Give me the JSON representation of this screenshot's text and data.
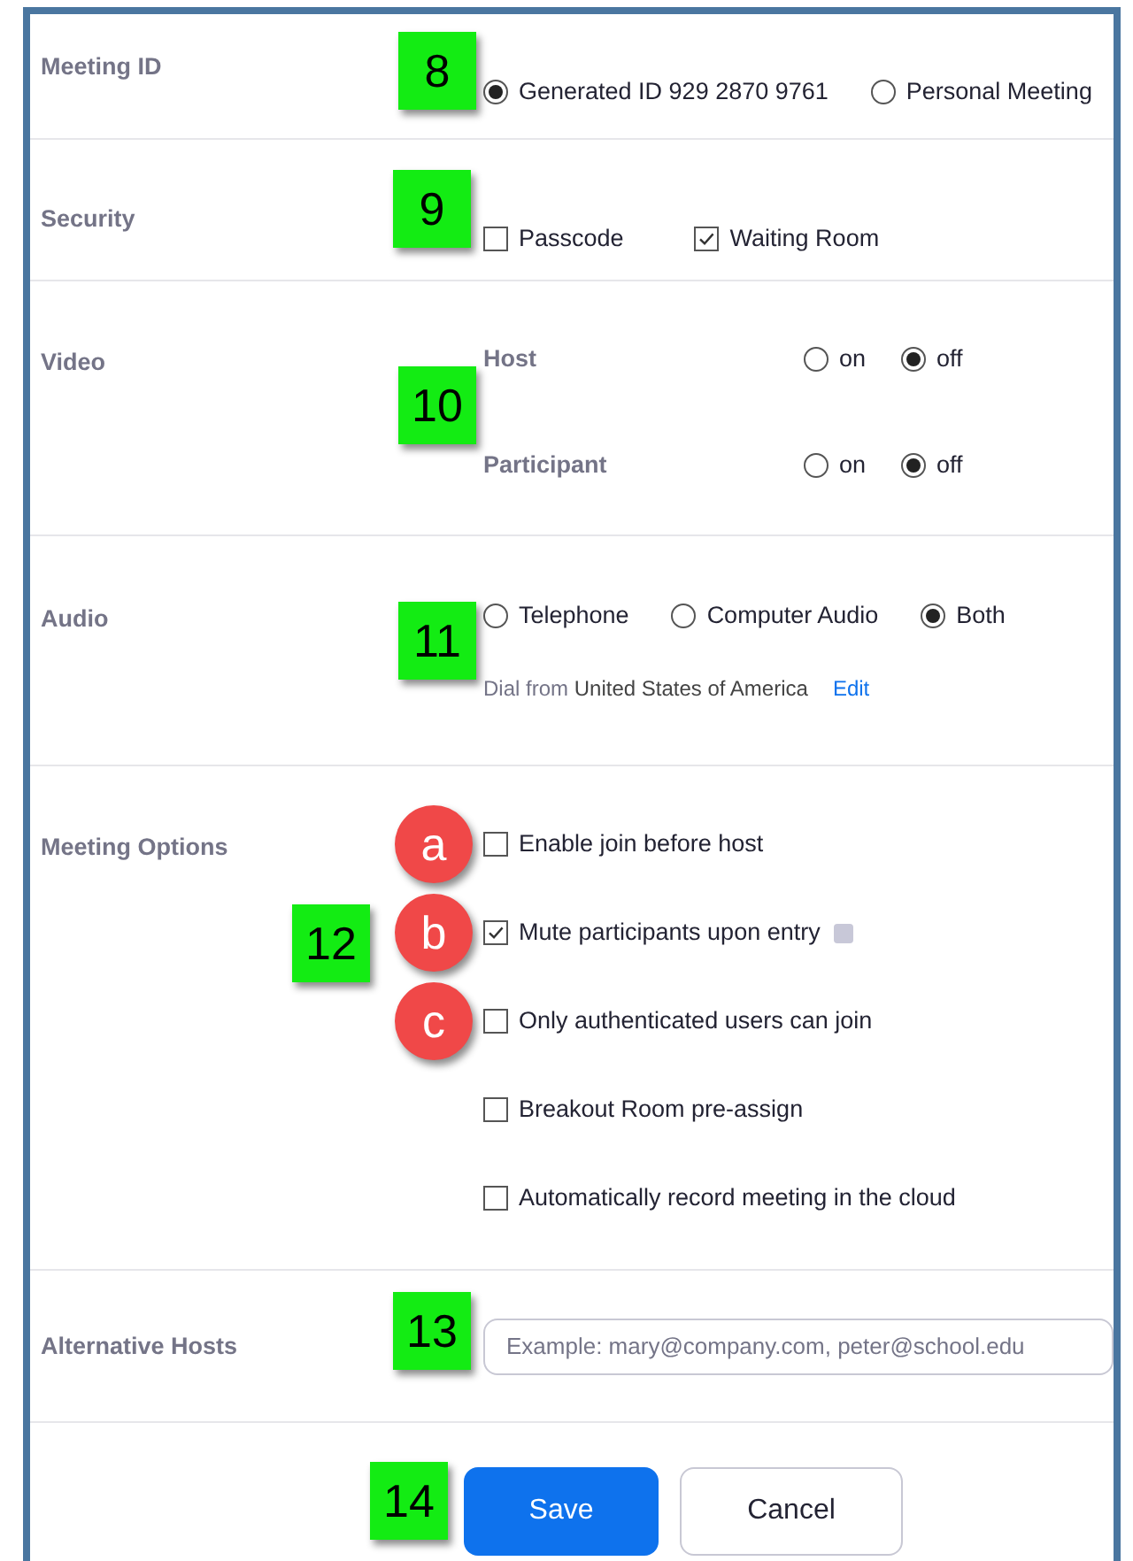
{
  "sections": [
    {
      "kind": "radio",
      "label": "Meeting ID",
      "badge": {
        "kind": "square",
        "label": "8"
      },
      "options": [
        {
          "label": "Generated ID 929 2870 9761",
          "selected": true
        },
        {
          "label": "Personal Meeting",
          "selected": false
        }
      ]
    },
    {
      "kind": "checkboxes",
      "label": "Security",
      "badge": {
        "kind": "square",
        "label": "9"
      },
      "options": [
        {
          "label": "Passcode",
          "checked": false
        },
        {
          "label": "Waiting Room",
          "checked": true
        }
      ]
    },
    {
      "kind": "video",
      "label": "Video",
      "badge": {
        "kind": "square",
        "label": "10"
      },
      "rows": [
        {
          "label": "Host",
          "options": [
            {
              "label": "on",
              "selected": false
            },
            {
              "label": "off",
              "selected": true
            }
          ]
        },
        {
          "label": "Participant",
          "options": [
            {
              "label": "on",
              "selected": false
            },
            {
              "label": "off",
              "selected": true
            }
          ]
        }
      ]
    },
    {
      "kind": "audio",
      "label": "Audio",
      "badge": {
        "kind": "square",
        "label": "11"
      },
      "options": [
        {
          "label": "Telephone",
          "selected": false
        },
        {
          "label": "Computer Audio",
          "selected": false
        },
        {
          "label": "Both",
          "selected": true
        }
      ],
      "dial_from": "Dial from",
      "country": "United States of America",
      "edit": "Edit"
    },
    {
      "kind": "options",
      "label": "Meeting Options",
      "badge": {
        "kind": "square",
        "label": "12"
      },
      "options": [
        {
          "label": "Enable join before host",
          "checked": false,
          "badge": {
            "kind": "circle",
            "label": "a"
          }
        },
        {
          "label": "Mute participants upon entry",
          "checked": true,
          "info": true,
          "badge": {
            "kind": "circle",
            "label": "b"
          }
        },
        {
          "label": "Only authenticated users can join",
          "checked": false,
          "badge": {
            "kind": "circle",
            "label": "c"
          }
        },
        {
          "label": "Breakout Room pre-assign",
          "checked": false
        },
        {
          "label": "Automatically record meeting in the cloud",
          "checked": false
        }
      ]
    },
    {
      "kind": "field",
      "label": "Alternative Hosts",
      "badge": {
        "kind": "square",
        "label": "13"
      },
      "placeholder": "Example: mary@company.com, peter@school.edu"
    }
  ],
  "actions": {
    "badge": {
      "kind": "square",
      "label": "14"
    },
    "save": "Save",
    "cancel": "Cancel"
  }
}
